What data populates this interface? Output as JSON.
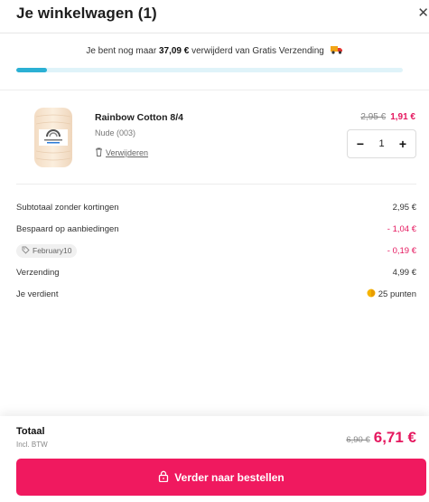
{
  "header": {
    "title": "Je winkelwagen (1)",
    "close_icon": "close-icon"
  },
  "shipping": {
    "text_before": "Je bent nog maar",
    "amount": "37,09 €",
    "text_after": "verwijderd van Gratis Verzending",
    "icon": "truck-icon",
    "progress_percent": 8,
    "progress_color": "#2bb0d4"
  },
  "cart_item": {
    "name": "Rainbow Cotton 8/4",
    "variant": "Nude (003)",
    "remove_label": "Verwijderen",
    "old_price": "2,95 €",
    "new_price": "1,91 €",
    "quantity": "1",
    "minus_label": "−",
    "plus_label": "+"
  },
  "summary": {
    "subtotal_label": "Subtotaal zonder kortingen",
    "subtotal_value": "2,95 €",
    "saved_label": "Bespaard op aanbiedingen",
    "saved_value": "- 1,04 €",
    "coupon_code": "February10",
    "coupon_value": "- 0,19 €",
    "shipping_label": "Verzending",
    "shipping_value": "4,99 €",
    "earn_label": "Je verdient",
    "earn_value": "25 punten"
  },
  "footer": {
    "total_label": "Totaal",
    "incl_label": "Incl. BTW",
    "total_old": "6,90 €",
    "total_new": "6,71 €",
    "cta_label": "Verder naar bestellen"
  },
  "colors": {
    "accent": "#f0195f",
    "sale": "#e5185f",
    "progress": "#2bb0d4"
  }
}
